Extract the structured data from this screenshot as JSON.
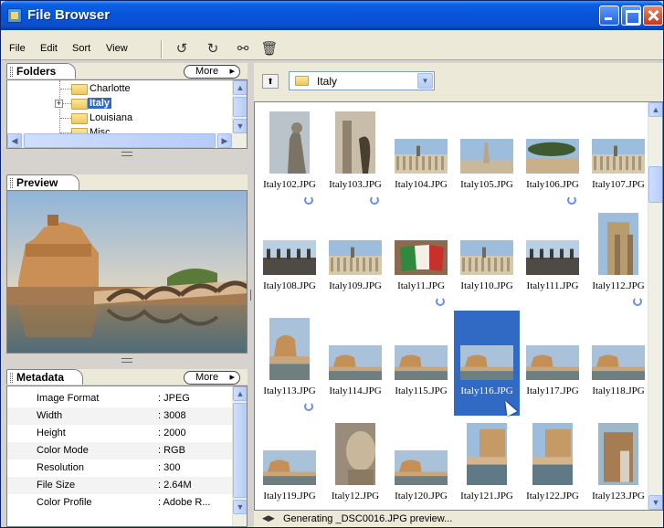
{
  "window": {
    "title": "File Browser"
  },
  "menu": [
    "File",
    "Edit",
    "Sort",
    "View"
  ],
  "toolbar": [
    {
      "icon": "rotate-ccw-icon",
      "glyph": "↺"
    },
    {
      "icon": "rotate-cw-icon",
      "glyph": "↻"
    },
    {
      "icon": "binoculars-icon",
      "glyph": "⚯"
    },
    {
      "icon": "trash-icon",
      "glyph": "🗑"
    }
  ],
  "folders": {
    "tab_label": "Folders",
    "more_label": "More",
    "items": [
      {
        "label": "Charlotte",
        "selected": false,
        "expandable": false
      },
      {
        "label": "Italy",
        "selected": true,
        "expandable": true
      },
      {
        "label": "Louisiana",
        "selected": false,
        "expandable": false
      },
      {
        "label": "Misc",
        "selected": false,
        "expandable": false
      }
    ]
  },
  "preview": {
    "tab_label": "Preview"
  },
  "metadata": {
    "tab_label": "Metadata",
    "more_label": "More",
    "rows": [
      {
        "key": "Image Format",
        "value": ": JPEG"
      },
      {
        "key": "Width",
        "value": ": 3008"
      },
      {
        "key": "Height",
        "value": ": 2000"
      },
      {
        "key": "Color Mode",
        "value": ": RGB"
      },
      {
        "key": "Resolution",
        "value": ": 300"
      },
      {
        "key": "File Size",
        "value": ": 2.64M"
      },
      {
        "key": "Color Profile",
        "value": ": Adobe R..."
      }
    ]
  },
  "path": {
    "current": "Italy"
  },
  "thumbnails": [
    {
      "name": "Italy102.JPG",
      "kind": "statue",
      "portrait": true,
      "rotate": true
    },
    {
      "name": "Italy103.JPG",
      "kind": "lamp",
      "portrait": true,
      "rotate": true
    },
    {
      "name": "Italy104.JPG",
      "kind": "colonnade",
      "portrait": false,
      "rotate": false
    },
    {
      "name": "Italy105.JPG",
      "kind": "obelisk",
      "portrait": false,
      "rotate": false
    },
    {
      "name": "Italy106.JPG",
      "kind": "trees",
      "portrait": false,
      "rotate": true
    },
    {
      "name": "Italy107.JPG",
      "kind": "colonnade",
      "portrait": false,
      "rotate": false
    },
    {
      "name": "Italy108.JPG",
      "kind": "rooftop",
      "portrait": false,
      "rotate": false
    },
    {
      "name": "Italy109.JPG",
      "kind": "colonnade",
      "portrait": false,
      "rotate": false
    },
    {
      "name": "Italy11.JPG",
      "kind": "flag",
      "portrait": false,
      "rotate": true
    },
    {
      "name": "Italy110.JPG",
      "kind": "colonnade",
      "portrait": false,
      "rotate": false
    },
    {
      "name": "Italy111.JPG",
      "kind": "rooftop",
      "portrait": false,
      "rotate": false
    },
    {
      "name": "Italy112.JPG",
      "kind": "portico",
      "portrait": true,
      "rotate": true
    },
    {
      "name": "Italy113.JPG",
      "kind": "castle",
      "portrait": true,
      "rotate": true
    },
    {
      "name": "Italy114.JPG",
      "kind": "castle",
      "portrait": false,
      "rotate": false
    },
    {
      "name": "Italy115.JPG",
      "kind": "castle",
      "portrait": false,
      "rotate": false
    },
    {
      "name": "Italy116.JPG",
      "kind": "castle",
      "portrait": false,
      "rotate": false,
      "selected": true
    },
    {
      "name": "Italy117.JPG",
      "kind": "castle",
      "portrait": false,
      "rotate": false
    },
    {
      "name": "Italy118.JPG",
      "kind": "castle",
      "portrait": false,
      "rotate": false
    },
    {
      "name": "Italy119.JPG",
      "kind": "castle",
      "portrait": false,
      "rotate": false
    },
    {
      "name": "Italy12.JPG",
      "kind": "bust",
      "portrait": true,
      "rotate": false
    },
    {
      "name": "Italy120.JPG",
      "kind": "castle",
      "portrait": false,
      "rotate": false
    },
    {
      "name": "Italy121.JPG",
      "kind": "bridge",
      "portrait": true,
      "rotate": false
    },
    {
      "name": "Italy122.JPG",
      "kind": "bridge",
      "portrait": true,
      "rotate": false
    },
    {
      "name": "Italy123.JPG",
      "kind": "colosseum",
      "portrait": true,
      "rotate": false
    }
  ],
  "status": {
    "text": "Generating _DSC0016.JPG preview..."
  }
}
